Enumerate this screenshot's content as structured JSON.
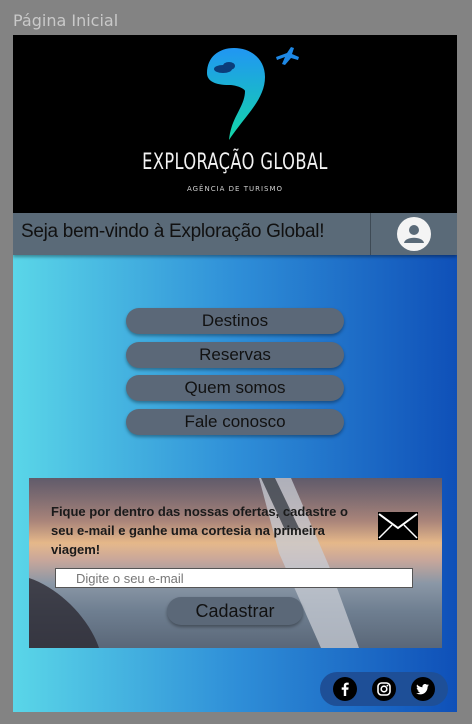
{
  "page_label": "Página Inicial",
  "brand": {
    "name": "EXPLORAÇÃO GLOBAL",
    "tagline": "AGÊNCIA DE TURISMO"
  },
  "welcome": {
    "text": "Seja bem-vindo à Exploração Global!",
    "avatar_icon": "user-icon"
  },
  "nav": {
    "items": [
      {
        "label": "Destinos"
      },
      {
        "label": "Reservas"
      },
      {
        "label": "Quem somos"
      },
      {
        "label": "Fale conosco"
      }
    ]
  },
  "newsletter": {
    "text": "Fique por dentro das nossas ofertas, cadastre o seu e-mail e ganhe uma cortesia na primeira viagem!",
    "input_placeholder": "Digite o seu e-mail",
    "input_value": "",
    "submit_label": "Cadastrar",
    "icon": "envelope-icon"
  },
  "social": {
    "icons": [
      "facebook-icon",
      "instagram-icon",
      "twitter-icon"
    ]
  },
  "colors": {
    "header_bg": "#000000",
    "welcome_bar": "#5a6a78",
    "button_bg": "#5b6878",
    "gradient_start": "#5ad6e8",
    "gradient_end": "#0f50b8",
    "social_bg": "#1e4f97"
  }
}
